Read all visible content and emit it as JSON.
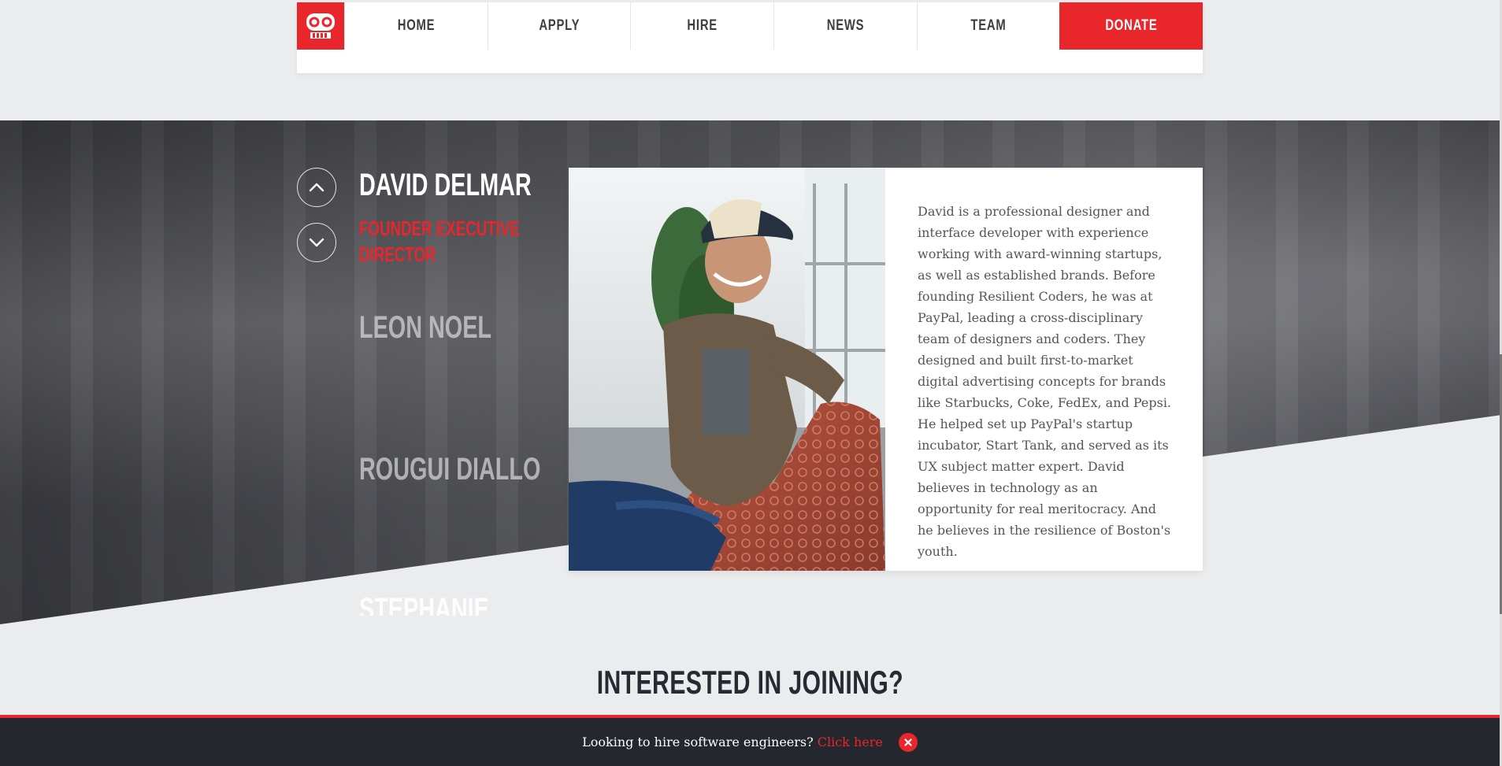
{
  "nav": {
    "logo_icon": "robot-logo-icon",
    "items": [
      {
        "label": "HOME"
      },
      {
        "label": "APPLY"
      },
      {
        "label": "HIRE"
      },
      {
        "label": "NEWS"
      },
      {
        "label": "TEAM"
      },
      {
        "label": "DONATE"
      }
    ],
    "accent_color": "#e8262b"
  },
  "team": {
    "active": {
      "name": "DAVID DELMAR",
      "role": "FOUNDER EXECUTIVE DIRECTOR",
      "role_lines": [
        "FOUNDER EXECUTIVE",
        "DIRECTOR"
      ],
      "bio": "David is a professional designer and interface developer with experience working with award-winning startups, as well as established brands. Before founding Resilient Coders, he was at PayPal, leading a cross-disciplinary team of designers and coders. They designed and built first-to-market digital advertising concepts for brands like Starbucks, Coke, FedEx, and Pepsi. He helped set up PayPal's startup incubator, Start Tank, and served as its UX subject matter expert. David believes in technology as an opportunity for real meritocracy. And he believes in the resilience of Boston's youth."
    },
    "others": [
      "LEON NOEL",
      "ROUGUI DIALLO",
      "STEPHANIE"
    ],
    "prev_icon": "chevron-up-icon",
    "next_icon": "chevron-down-icon"
  },
  "joining": {
    "heading": "INTERESTED IN JOINING?"
  },
  "footer": {
    "text": "Looking to hire software engineers?",
    "link": "Click here",
    "close_icon": "close-icon"
  }
}
